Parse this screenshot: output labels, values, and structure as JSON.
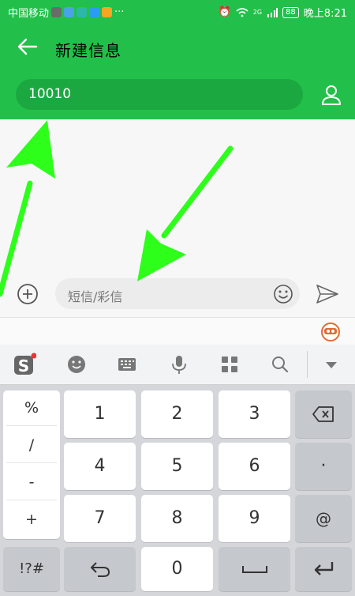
{
  "status_bar": {
    "carrier": "中国移动",
    "more": "···",
    "battery": "88",
    "signal_badge": "2G",
    "time": "晚上8:21"
  },
  "header": {
    "title": "新建信息",
    "recipient_value": "10010"
  },
  "composer": {
    "placeholder": "短信/彩信"
  },
  "ime_toolbar": {
    "icons": [
      "sogou-logo-icon",
      "emoji-face-icon",
      "keyboard-icon",
      "microphone-icon",
      "apps-grid-icon",
      "search-icon",
      "collapse-keyboard-icon"
    ]
  },
  "keyboard": {
    "symbols": [
      "%",
      "/",
      "-",
      "+"
    ],
    "digits": [
      "1",
      "2",
      "3",
      "4",
      "5",
      "6",
      "7",
      "8",
      "9",
      "0"
    ],
    "right_keys": {
      "dot": "·",
      "at": "@"
    },
    "bottom_left": "!?#"
  },
  "colors": {
    "header_green": "#22c04a",
    "arrow_green": "#2dff1b"
  }
}
